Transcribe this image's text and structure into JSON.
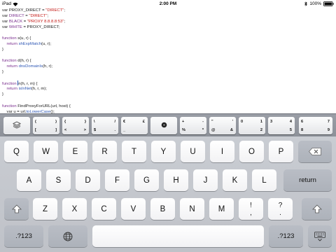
{
  "status_bar": {
    "device": "iPad",
    "time": "2:00 PM",
    "battery": "100%"
  },
  "editor": {
    "lines": [
      [
        {
          "t": "var PROXY_DIRECT = ",
          "c": "plain"
        },
        {
          "t": "\"DIRECT\"",
          "c": "str"
        },
        {
          "t": ";",
          "c": "plain"
        }
      ],
      [
        {
          "t": "var ",
          "c": "plain"
        },
        {
          "t": "DIRECT",
          "c": "kw"
        },
        {
          "t": " = ",
          "c": "plain"
        },
        {
          "t": "\"DIRECT\"",
          "c": "str"
        },
        {
          "t": ";",
          "c": "plain"
        }
      ],
      [
        {
          "t": "var ",
          "c": "plain"
        },
        {
          "t": "BLACK",
          "c": "kw"
        },
        {
          "t": " = ",
          "c": "plain"
        },
        {
          "t": "\"PROXY 8.8.8.8:53\"",
          "c": "str"
        },
        {
          "t": ";",
          "c": "plain"
        }
      ],
      [
        {
          "t": "var ",
          "c": "plain"
        },
        {
          "t": "WHITE",
          "c": "kw"
        },
        {
          "t": " = PROXY_DIRECT;",
          "c": "plain"
        }
      ],
      [],
      [
        {
          "t": "function",
          "c": "kw"
        },
        {
          "t": " s(u, r) {",
          "c": "plain"
        }
      ],
      [
        {
          "t": "    return ",
          "c": "kw"
        },
        {
          "t": "shExpMatch",
          "c": "fn"
        },
        {
          "t": "(u, r);",
          "c": "plain"
        }
      ],
      [
        {
          "t": "}",
          "c": "plain"
        }
      ],
      [],
      [
        {
          "t": "function",
          "c": "kw"
        },
        {
          "t": " d(h, r) {",
          "c": "plain"
        }
      ],
      [
        {
          "t": "    return ",
          "c": "kw"
        },
        {
          "t": "dnsDomainIs",
          "c": "fn"
        },
        {
          "t": "(h, r);",
          "c": "plain"
        }
      ],
      [
        {
          "t": "}",
          "c": "plain"
        }
      ],
      [],
      [
        {
          "t": "function",
          "c": "kw"
        },
        {
          "t": " ",
          "c": "plain"
        },
        {
          "t": "|",
          "c": "cursor"
        },
        {
          "t": "n(h, r, m) {",
          "c": "plain"
        }
      ],
      [
        {
          "t": "    return ",
          "c": "kw"
        },
        {
          "t": "isInNet",
          "c": "fn"
        },
        {
          "t": "(h, r, m);",
          "c": "plain"
        }
      ],
      [
        {
          "t": "}",
          "c": "plain"
        }
      ],
      [],
      [
        {
          "t": "function",
          "c": "kw"
        },
        {
          "t": " FindProxyForURL(url, host) {",
          "c": "plain"
        }
      ],
      [
        {
          "t": "    var u = url.",
          "c": "plain"
        },
        {
          "t": "toLowerCase",
          "c": "fn"
        },
        {
          "t": "();",
          "c": "plain"
        }
      ]
    ]
  },
  "extra_keys": [
    {
      "name": "extra-key-layers",
      "icon": "layers-icon",
      "single": ""
    },
    {
      "name": "extra-key-parens-brackets",
      "tl": "(",
      "tr": ")",
      "bl": "[",
      "br": "]"
    },
    {
      "name": "extra-key-braces-angles",
      "tl": "{",
      "tr": "}",
      "bl": "<",
      "br": ">"
    },
    {
      "name": "extra-key-slash-dollar",
      "tl": "\\",
      "tr": "/",
      "bl": "$",
      "br": "."
    },
    {
      "name": "extra-key-currency",
      "tl": "€",
      "tr": "£",
      "bl": "_",
      "br": ""
    },
    {
      "name": "extra-key-cursor",
      "icon": "cursor-dot-icon",
      "single": ""
    },
    {
      "name": "extra-key-math",
      "tl": "+",
      "tr": "-",
      "bl": "%",
      "br": "*"
    },
    {
      "name": "extra-key-quotes",
      "tl": "\"",
      "tr": "'",
      "bl": "@",
      "br": "&"
    },
    {
      "name": "extra-key-digits-0-2",
      "tl": "0",
      "tr": "1",
      "bl": "",
      "br": "2"
    },
    {
      "name": "extra-key-digits-3-5",
      "tl": "3",
      "tr": "4",
      "bl": "",
      "br": "5"
    },
    {
      "name": "extra-key-digits-6-9",
      "tl": "6",
      "tr": "7",
      "bl": "8",
      "br": "9"
    }
  ],
  "keyboard": {
    "row1": [
      "Q",
      "W",
      "E",
      "R",
      "T",
      "Y",
      "U",
      "I",
      "O",
      "P"
    ],
    "row2": [
      "A",
      "S",
      "D",
      "F",
      "G",
      "H",
      "J",
      "K",
      "L"
    ],
    "row3": [
      "Z",
      "X",
      "C",
      "V",
      "B",
      "N",
      "M"
    ],
    "row3_punct": [
      {
        "top": "!",
        "bottom": ","
      },
      {
        "top": "?",
        "bottom": "."
      }
    ],
    "return_label": "return",
    "numbers_label": ".?123"
  },
  "icons": [
    "backspace-icon",
    "shift-icon",
    "globe-icon",
    "keyboard-dismiss-icon",
    "wifi-icon",
    "bluetooth-icon",
    "battery-icon"
  ]
}
